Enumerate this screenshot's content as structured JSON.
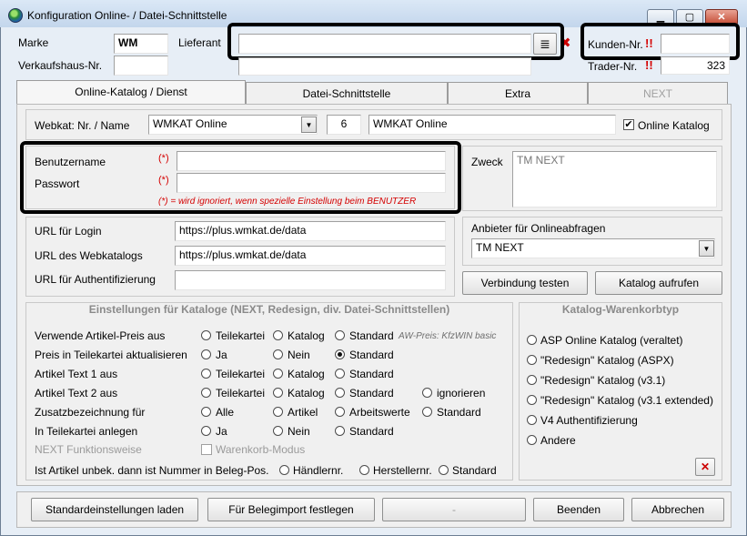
{
  "window": {
    "title": "Konfiguration Online- / Datei-Schnittstelle",
    "btn_minimize": "▁",
    "btn_maximize": "▢",
    "btn_close": "✕"
  },
  "header": {
    "marke_label": "Marke",
    "marke_value": "WM",
    "lieferant_label": "Lieferant",
    "lieferant_value": "",
    "lieferant_list_glyph": "≣",
    "lieferant_clear_glyph": "✖",
    "verkaufshaus_label": "Verkaufshaus-Nr.",
    "verkaufshaus_value": "",
    "verkaufshaus_value2": "",
    "kunden_label": "Kunden-Nr.",
    "kunden_value": "",
    "trader_label": "Trader-Nr.",
    "trader_value": "323",
    "required_mark": "!!"
  },
  "tabs": [
    "Online-Katalog / Dienst",
    "Datei-Schnittstelle",
    "Extra",
    "NEXT"
  ],
  "webkat": {
    "label": "Webkat: Nr. / Name",
    "select_value": "WMKAT Online",
    "nr": "6",
    "name": "WMKAT Online",
    "online_checkbox_label": "Online Katalog",
    "online_checked": true
  },
  "credentials": {
    "benutzer_label": "Benutzername",
    "passwort_label": "Passwort",
    "req_marker": "(*)",
    "note": "(*) = wird ignoriert, wenn spezielle Einstellung beim BENUTZER",
    "benutzer_value": "",
    "passwort_value": ""
  },
  "zweck": {
    "label": "Zweck",
    "value": "TM NEXT"
  },
  "urls": {
    "login_label": "URL für Login",
    "login_value": "https://plus.wmkat.de/data",
    "webkatalog_label": "URL des Webkatalogs",
    "webkatalog_value": "https://plus.wmkat.de/data",
    "auth_label": "URL für Authentifizierung",
    "auth_value": ""
  },
  "anbieter": {
    "label": "Anbieter für Onlineabfragen",
    "value": "TM NEXT"
  },
  "buttons": {
    "verbindung": "Verbindung testen",
    "katalog": "Katalog aufrufen",
    "standard_laden": "Standardeinstellungen laden",
    "belegimport": "Für Belegimport festlegen",
    "dash": "-",
    "beenden": "Beenden",
    "abbrechen": "Abbrechen"
  },
  "settings": {
    "title": "Einstellungen für Kataloge (NEXT, Redesign, div. Datei-Schnittstellen)",
    "aw_note": "AW-Preis: KfzWIN basic",
    "rows": [
      {
        "label": "Verwende Artikel-Preis aus",
        "options": [
          "Teilekartei",
          "Katalog",
          "Standard"
        ],
        "selected": -1
      },
      {
        "label": "Preis in Teilekartei aktualisieren",
        "options": [
          "Ja",
          "Nein",
          "Standard"
        ],
        "selected": 2
      },
      {
        "label": "Artikel Text 1 aus",
        "options": [
          "Teilekartei",
          "Katalog",
          "Standard"
        ],
        "selected": -1
      },
      {
        "label": "Artikel Text 2 aus",
        "options": [
          "Teilekartei",
          "Katalog",
          "Standard",
          "ignorieren"
        ],
        "selected": -1
      },
      {
        "label": "Zusatzbezeichnung für",
        "options": [
          "Alle",
          "Artikel",
          "Arbeitswerte",
          "Standard"
        ],
        "selected": -1
      },
      {
        "label": "In Teilekartei anlegen",
        "options": [
          "Ja",
          "Nein",
          "Standard"
        ],
        "selected": -1
      }
    ],
    "next_label": "NEXT Funktionsweise",
    "warenkorb_label": "Warenkorb-Modus",
    "unbek_label": "Ist Artikel unbek. dann ist Nummer in Beleg-Pos.",
    "unbek_options": [
      "Händlernr.",
      "Herstellernr.",
      "Standard"
    ]
  },
  "warenkorb": {
    "title": "Katalog-Warenkorbtyp",
    "options": [
      "ASP Online Katalog (veraltet)",
      "\"Redesign\" Katalog (ASPX)",
      "\"Redesign\" Katalog (v3.1)",
      "\"Redesign\" Katalog (v3.1 extended)",
      "V4 Authentifizierung",
      "Andere"
    ],
    "delete_glyph": "✕"
  },
  "icons": {
    "dropdown": "▼",
    "check": "✔"
  }
}
